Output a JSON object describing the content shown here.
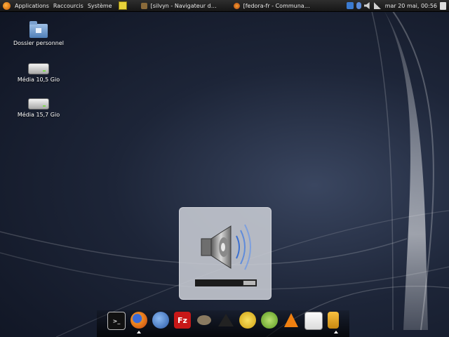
{
  "top_panel": {
    "menus": [
      "Applications",
      "Raccourcis",
      "Système"
    ],
    "tasks": [
      {
        "label": "[silvyn - Navigateur d…",
        "icon": "folder-icon"
      },
      {
        "label": "[fedora-fr - Communa…",
        "icon": "firefox-icon"
      }
    ],
    "clock": "mar 20 mai, 00:56",
    "tray_icons": [
      "updates-icon",
      "bluetooth-icon",
      "volume-icon",
      "network-signal-icon",
      "power-icon"
    ]
  },
  "desktop": {
    "icons": [
      {
        "label": "Dossier personnel",
        "icon": "home-folder-icon"
      },
      {
        "label": "Média 10,5 Gio",
        "icon": "drive-icon"
      },
      {
        "label": "Média 15,7 Gio",
        "icon": "drive-icon"
      }
    ]
  },
  "volume_osd": {
    "icon": "speaker-icon",
    "level_fraction": 0.9
  },
  "dock": {
    "items": [
      {
        "name": "terminal",
        "icon": "terminal-icon",
        "running": false
      },
      {
        "name": "firefox",
        "icon": "firefox-icon",
        "running": true
      },
      {
        "name": "thunderbird",
        "icon": "thunderbird-icon",
        "running": false
      },
      {
        "name": "filezilla",
        "icon": "filezilla-icon",
        "running": false
      },
      {
        "name": "gimp",
        "icon": "gimp-icon",
        "running": false
      },
      {
        "name": "inkscape",
        "icon": "inkscape-icon",
        "running": false
      },
      {
        "name": "banshee",
        "icon": "music-player-icon",
        "running": false
      },
      {
        "name": "dreamweaver",
        "icon": "dreamweaver-icon",
        "running": false
      },
      {
        "name": "vlc",
        "icon": "vlc-icon",
        "running": false
      },
      {
        "name": "text-editor",
        "icon": "text-editor-icon",
        "running": false
      },
      {
        "name": "notes",
        "icon": "notes-icon",
        "running": true
      }
    ]
  }
}
